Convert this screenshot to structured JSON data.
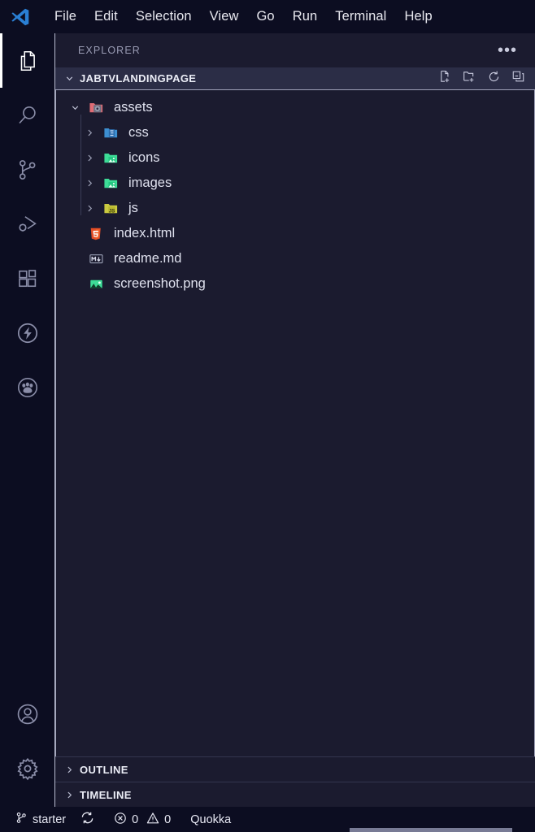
{
  "window": {
    "app": "Visual Studio Code",
    "logo_icon": "vscode-logo-icon"
  },
  "menubar": {
    "items": [
      {
        "label": "File"
      },
      {
        "label": "Edit"
      },
      {
        "label": "Selection"
      },
      {
        "label": "View"
      },
      {
        "label": "Go"
      },
      {
        "label": "Run"
      },
      {
        "label": "Terminal"
      },
      {
        "label": "Help"
      }
    ]
  },
  "activitybar": {
    "items": [
      {
        "name": "explorer",
        "icon": "files-icon",
        "active": true
      },
      {
        "name": "search",
        "icon": "search-icon",
        "active": false
      },
      {
        "name": "source-control",
        "icon": "source-control-icon",
        "active": false
      },
      {
        "name": "run-and-debug",
        "icon": "run-debug-icon",
        "active": false
      },
      {
        "name": "extensions",
        "icon": "extensions-icon",
        "active": false
      },
      {
        "name": "thunder-client",
        "icon": "lightning-bolt-icon",
        "active": false
      },
      {
        "name": "quokka",
        "icon": "paw-print-icon",
        "active": false
      }
    ],
    "bottom_items": [
      {
        "name": "accounts",
        "icon": "account-icon"
      },
      {
        "name": "settings",
        "icon": "gear-icon"
      }
    ]
  },
  "sidebar": {
    "title": "EXPLORER",
    "more_actions": "•••",
    "folder": {
      "name": "JABTVLANDINGPAGE",
      "expanded": true,
      "actions": [
        {
          "name": "new-file",
          "icon": "new-file-icon",
          "tooltip": "New File"
        },
        {
          "name": "new-folder",
          "icon": "new-folder-icon",
          "tooltip": "New Folder"
        },
        {
          "name": "refresh",
          "icon": "refresh-icon",
          "tooltip": "Refresh Explorer"
        },
        {
          "name": "collapse-all",
          "icon": "collapse-all-icon",
          "tooltip": "Collapse Folders in Explorer"
        }
      ]
    },
    "tree": [
      {
        "label": "assets",
        "type": "folder",
        "depth": 0,
        "expanded": true,
        "icon": "folder-assets-icon",
        "color": "#e06c75"
      },
      {
        "label": "css",
        "type": "folder",
        "depth": 1,
        "expanded": false,
        "icon": "folder-css-icon",
        "color": "#3d8fd1"
      },
      {
        "label": "icons",
        "type": "folder",
        "depth": 1,
        "expanded": false,
        "icon": "folder-images-icon",
        "color": "#3ddc97"
      },
      {
        "label": "images",
        "type": "folder",
        "depth": 1,
        "expanded": false,
        "icon": "folder-images-icon",
        "color": "#3ddc97"
      },
      {
        "label": "js",
        "type": "folder",
        "depth": 1,
        "expanded": false,
        "icon": "folder-js-icon",
        "color": "#cbcb41"
      },
      {
        "label": "index.html",
        "type": "file",
        "depth": 1,
        "icon": "html5-icon",
        "color": "#e44d26"
      },
      {
        "label": "readme.md",
        "type": "file",
        "depth": 1,
        "icon": "markdown-icon",
        "color": "#9aa0b5"
      },
      {
        "label": "screenshot.png",
        "type": "file",
        "depth": 1,
        "icon": "image-icon",
        "color": "#3ddc97"
      }
    ],
    "sections": [
      {
        "label": "OUTLINE",
        "expanded": false
      },
      {
        "label": "TIMELINE",
        "expanded": false
      }
    ]
  },
  "statusbar": {
    "branch": "starter",
    "sync_icon": "sync-icon",
    "errors": "0",
    "warnings": "0",
    "quokka": "Quokka"
  },
  "colors": {
    "activitybar_bg": "#0c0d21",
    "sidebar_bg": "#1b1b2f",
    "folder_header_bg": "#2b2d46",
    "statusbar_bg": "#0c0d21",
    "text": "#dfe1ee",
    "muted": "#9a9cb4",
    "accent": "#ffffff"
  }
}
